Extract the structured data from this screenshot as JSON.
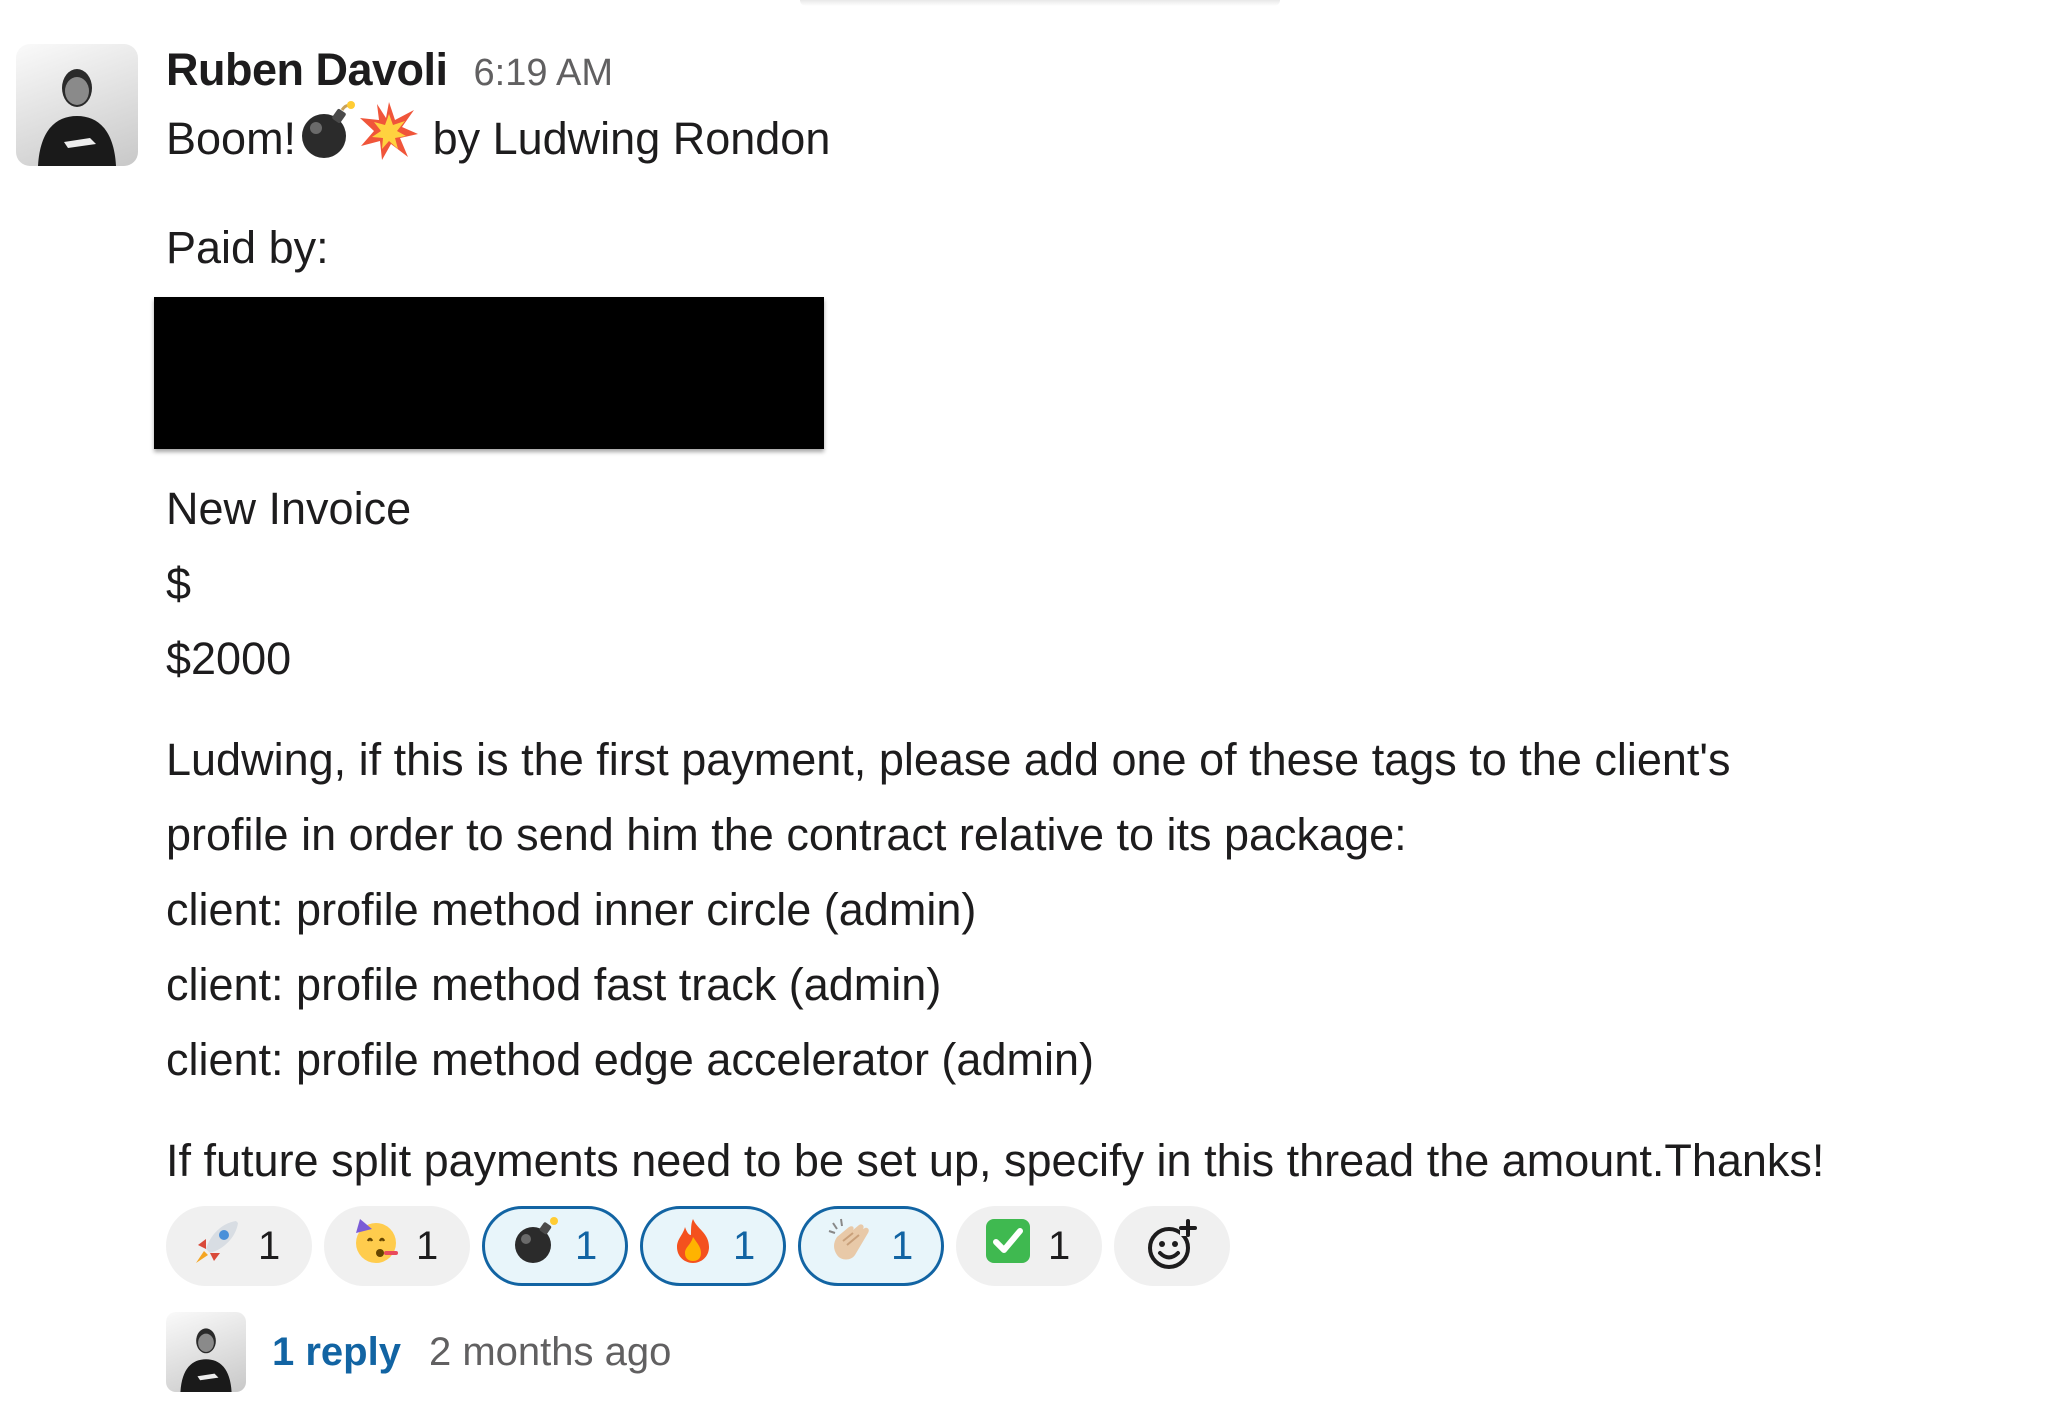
{
  "message": {
    "author": "Ruben Davoli",
    "time": "6:19 AM",
    "first_line": {
      "prefix": "Boom!",
      "emojis": [
        "bomb-icon",
        "collision-icon"
      ],
      "suffix": " by Ludwing Rondon"
    },
    "paid_by_label": "Paid by:",
    "invoice_title": "New Invoice",
    "currency_symbol": "$",
    "amount": "$2000",
    "instructions": [
      "Ludwing, if this is the first payment, please add one of these tags to the client's",
      "profile in order to send him the contract relative to its package:",
      "client: profile method inner circle (admin)",
      "client: profile method fast track (admin)",
      "client: profile method edge accelerator (admin)"
    ],
    "closing": "If future split payments need to be set up, specify in this thread the amount.Thanks!"
  },
  "reactions": [
    {
      "icon": "rocket-icon",
      "count": "1",
      "active": false
    },
    {
      "icon": "partying-face-icon",
      "count": "1",
      "active": false
    },
    {
      "icon": "bomb-icon",
      "count": "1",
      "active": true
    },
    {
      "icon": "fire-icon",
      "count": "1",
      "active": true
    },
    {
      "icon": "clapping-hands-icon",
      "count": "1",
      "active": true
    },
    {
      "icon": "check-mark-button-icon",
      "count": "1",
      "active": false
    }
  ],
  "add_reaction_icon": "add-reaction-icon",
  "thread": {
    "reply_count": "1 reply",
    "last_reply": "2 months ago"
  },
  "colors": {
    "link": "#1264a3",
    "muted": "#616061",
    "active_bg": "#e8f5fa",
    "reaction_bg": "#f0f0f0"
  }
}
